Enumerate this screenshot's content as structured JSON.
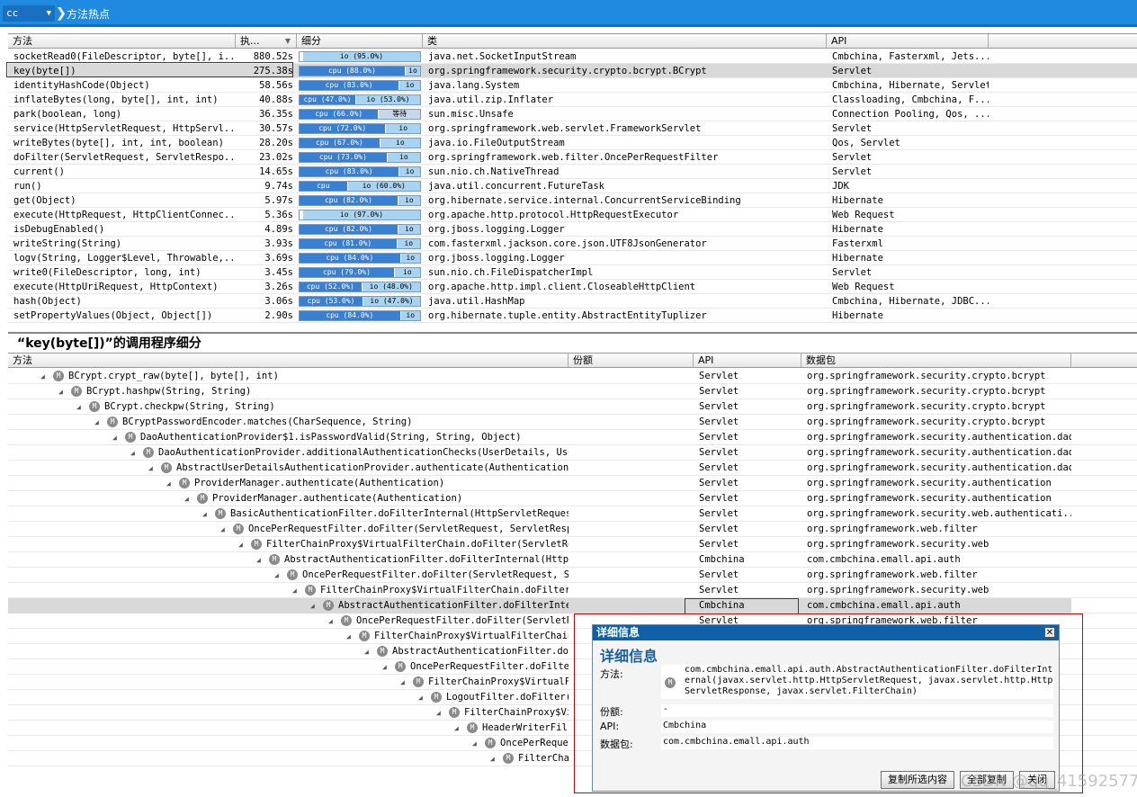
{
  "topbar": {
    "combo": "cc",
    "title": "方法热点"
  },
  "hot": {
    "headers": [
      "方法",
      "执...",
      "细分",
      "类",
      "API"
    ],
    "rows": [
      {
        "method": "socketRead0(FileDescriptor, byte[], i...",
        "time": "880.52s",
        "segs": [
          {
            "k": "io",
            "t": "io (95.0%)",
            "w": 0.97,
            "off": 0.03
          }
        ],
        "cls": "java.net.SocketInputStream",
        "api": "Cmbchina, Fasterxml, Jets..."
      },
      {
        "method": "key(byte[])",
        "time": "275.38s",
        "segs": [
          {
            "k": "cpu",
            "t": "cpu (88.0%)",
            "w": 0.88
          },
          {
            "k": "io",
            "t": "io",
            "w": 0.12
          }
        ],
        "cls": "org.springframework.security.crypto.bcrypt.BCrypt",
        "api": "Servlet"
      },
      {
        "method": "identityHashCode(Object)",
        "time": "58.56s",
        "segs": [
          {
            "k": "cpu",
            "t": "cpu (83.0%)",
            "w": 0.83
          },
          {
            "k": "io",
            "t": "io",
            "w": 0.17
          }
        ],
        "cls": "java.lang.System",
        "api": "Cmbchina, Hibernate, Servlet"
      },
      {
        "method": "inflateBytes(long, byte[], int, int)",
        "time": "40.88s",
        "segs": [
          {
            "k": "cpu",
            "t": "cpu (47.0%)",
            "w": 0.47
          },
          {
            "k": "io",
            "t": "io (53.0%)",
            "w": 0.53
          }
        ],
        "cls": "java.util.zip.Inflater",
        "api": "Classloading, Cmbchina, F..."
      },
      {
        "method": "park(boolean, long)",
        "time": "36.35s",
        "segs": [
          {
            "k": "cpu",
            "t": "cpu (66.0%)",
            "w": 0.66
          },
          {
            "k": "wait",
            "t": "等待",
            "w": 0.34
          }
        ],
        "cls": "sun.misc.Unsafe",
        "api": "Connection Pooling, Qos, ..."
      },
      {
        "method": "service(HttpServletRequest, HttpServl...",
        "time": "30.57s",
        "segs": [
          {
            "k": "cpu",
            "t": "cpu (72.0%)",
            "w": 0.72
          },
          {
            "k": "io",
            "t": "io",
            "w": 0.28
          }
        ],
        "cls": "org.springframework.web.servlet.FrameworkServlet",
        "api": "Servlet"
      },
      {
        "method": "writeBytes(byte[], int, int, boolean)",
        "time": "28.20s",
        "segs": [
          {
            "k": "cpu",
            "t": "cpu (67.0%)",
            "w": 0.67
          },
          {
            "k": "io",
            "t": "io",
            "w": 0.33
          }
        ],
        "cls": "java.io.FileOutputStream",
        "api": "Qos, Servlet"
      },
      {
        "method": "doFilter(ServletRequest, ServletRespo...",
        "time": "23.02s",
        "segs": [
          {
            "k": "cpu",
            "t": "cpu (73.0%)",
            "w": 0.73
          },
          {
            "k": "io",
            "t": "io",
            "w": 0.27
          }
        ],
        "cls": "org.springframework.web.filter.OncePerRequestFilter",
        "api": "Servlet"
      },
      {
        "method": "current()",
        "time": "14.65s",
        "segs": [
          {
            "k": "cpu",
            "t": "cpu (83.0%)",
            "w": 0.83
          },
          {
            "k": "io",
            "t": "io",
            "w": 0.17
          }
        ],
        "cls": "sun.nio.ch.NativeThread",
        "api": "Servlet"
      },
      {
        "method": "run()",
        "time": "9.74s",
        "segs": [
          {
            "k": "cpu",
            "t": "cpu",
            "w": 0.4
          },
          {
            "k": "io",
            "t": "io (60.0%)",
            "w": 0.6
          }
        ],
        "cls": "java.util.concurrent.FutureTask",
        "api": "JDK"
      },
      {
        "method": "get(Object)",
        "time": "5.97s",
        "segs": [
          {
            "k": "cpu",
            "t": "cpu (82.0%)",
            "w": 0.82
          },
          {
            "k": "io",
            "t": "io",
            "w": 0.18
          }
        ],
        "cls": "org.hibernate.service.internal.ConcurrentServiceBinding",
        "api": "Hibernate"
      },
      {
        "method": "execute(HttpRequest, HttpClientConnec...",
        "time": "5.36s",
        "segs": [
          {
            "k": "io",
            "t": "io (97.0%)",
            "w": 0.97,
            "off": 0.03
          }
        ],
        "cls": "org.apache.http.protocol.HttpRequestExecutor",
        "api": "Web Request"
      },
      {
        "method": "isDebugEnabled()",
        "time": "4.89s",
        "segs": [
          {
            "k": "cpu",
            "t": "cpu (82.0%)",
            "w": 0.82
          },
          {
            "k": "io",
            "t": "io",
            "w": 0.18
          }
        ],
        "cls": "org.jboss.logging.Logger",
        "api": "Hibernate"
      },
      {
        "method": "writeString(String)",
        "time": "3.93s",
        "segs": [
          {
            "k": "cpu",
            "t": "cpu (81.0%)",
            "w": 0.81
          },
          {
            "k": "io",
            "t": "io",
            "w": 0.19
          }
        ],
        "cls": "com.fasterxml.jackson.core.json.UTF8JsonGenerator",
        "api": "Fasterxml"
      },
      {
        "method": "logv(String, Logger$Level, Throwable,...",
        "time": "3.69s",
        "segs": [
          {
            "k": "cpu",
            "t": "cpu (84.0%)",
            "w": 0.84
          },
          {
            "k": "io",
            "t": "io",
            "w": 0.16
          }
        ],
        "cls": "org.jboss.logging.Logger",
        "api": "Hibernate"
      },
      {
        "method": "write0(FileDescriptor, long, int)",
        "time": "3.45s",
        "segs": [
          {
            "k": "cpu",
            "t": "cpu (79.0%)",
            "w": 0.79
          },
          {
            "k": "io",
            "t": "io",
            "w": 0.21
          }
        ],
        "cls": "sun.nio.ch.FileDispatcherImpl",
        "api": "Servlet"
      },
      {
        "method": "execute(HttpUriRequest, HttpContext)",
        "time": "3.26s",
        "segs": [
          {
            "k": "cpu",
            "t": "cpu (52.0%)",
            "w": 0.52
          },
          {
            "k": "io",
            "t": "io (48.0%)",
            "w": 0.48
          }
        ],
        "cls": "org.apache.http.impl.client.CloseableHttpClient",
        "api": "Web Request"
      },
      {
        "method": "hash(Object)",
        "time": "3.06s",
        "segs": [
          {
            "k": "cpu",
            "t": "cpu (53.0%)",
            "w": 0.53
          },
          {
            "k": "io",
            "t": "io (47.0%)",
            "w": 0.47
          }
        ],
        "cls": "java.util.HashMap",
        "api": "Cmbchina, Hibernate, JDBC..."
      },
      {
        "method": "setPropertyValues(Object, Object[])",
        "time": "2.90s",
        "segs": [
          {
            "k": "cpu",
            "t": "cpu (84.0%)",
            "w": 0.84
          },
          {
            "k": "io",
            "t": "io",
            "w": 0.16
          }
        ],
        "cls": "org.hibernate.tuple.entity.AbstractEntityTuplizer",
        "api": "Hibernate"
      }
    ]
  },
  "breakdown": {
    "title": "“key(byte[])”的调用程序细分",
    "headers": [
      "方法",
      "份额",
      "API",
      "数据包"
    ],
    "rows": [
      {
        "d": 0,
        "m": "BCrypt.crypt_raw(byte[], byte[], int)",
        "api": "Servlet",
        "pkg": "org.springframework.security.crypto.bcrypt"
      },
      {
        "d": 1,
        "m": "BCrypt.hashpw(String, String)",
        "api": "Servlet",
        "pkg": "org.springframework.security.crypto.bcrypt"
      },
      {
        "d": 2,
        "m": "BCrypt.checkpw(String, String)",
        "api": "Servlet",
        "pkg": "org.springframework.security.crypto.bcrypt"
      },
      {
        "d": 3,
        "m": "BCryptPasswordEncoder.matches(CharSequence, String)",
        "api": "Servlet",
        "pkg": "org.springframework.security.crypto.bcrypt"
      },
      {
        "d": 4,
        "m": "DaoAuthenticationProvider$1.isPasswordValid(String, String, Object)",
        "api": "Servlet",
        "pkg": "org.springframework.security.authentication.dao"
      },
      {
        "d": 5,
        "m": "DaoAuthenticationProvider.additionalAuthenticationChecks(UserDetails, Userna",
        "api": "Servlet",
        "pkg": "org.springframework.security.authentication.dao"
      },
      {
        "d": 6,
        "m": "AbstractUserDetailsAuthenticationProvider.authenticate(Authentication)",
        "api": "Servlet",
        "pkg": "org.springframework.security.authentication.dao"
      },
      {
        "d": 7,
        "m": "ProviderManager.authenticate(Authentication)",
        "api": "Servlet",
        "pkg": "org.springframework.security.authentication"
      },
      {
        "d": 8,
        "m": "ProviderManager.authenticate(Authentication)",
        "api": "Servlet",
        "pkg": "org.springframework.security.authentication"
      },
      {
        "d": 9,
        "m": "BasicAuthenticationFilter.doFilterInternal(HttpServletRequest,",
        "api": "Servlet",
        "pkg": "org.springframework.security.web.authenticati..."
      },
      {
        "d": 10,
        "m": "OncePerRequestFilter.doFilter(ServletRequest, ServletRespor",
        "api": "Servlet",
        "pkg": "org.springframework.web.filter"
      },
      {
        "d": 11,
        "m": "FilterChainProxy$VirtualFilterChain.doFilter(ServletReq",
        "api": "Servlet",
        "pkg": "org.springframework.security.web"
      },
      {
        "d": 12,
        "m": "AbstractAuthenticationFilter.doFilterInternal(HttpSe",
        "api": "Cmbchina",
        "pkg": "com.cmbchina.emall.api.auth"
      },
      {
        "d": 13,
        "m": "OncePerRequestFilter.doFilter(ServletRequest, Ser",
        "api": "Servlet",
        "pkg": "org.springframework.web.filter"
      },
      {
        "d": 14,
        "m": "FilterChainProxy$VirtualFilterChain.doFilter(S",
        "api": "Servlet",
        "pkg": "org.springframework.security.web"
      },
      {
        "d": 15,
        "m": "AbstractAuthenticationFilter.doFilterInter",
        "api": "Cmbchina",
        "pkg": "com.cmbchina.emall.api.auth"
      },
      {
        "d": 16,
        "m": "OncePerRequestFilter.doFilter(ServletRe",
        "api": "Servlet",
        "pkg": "org.springframework.web.filter"
      },
      {
        "d": 17,
        "m": "FilterChainProxy$VirtualFilterChain.",
        "api": "",
        "pkg": ""
      },
      {
        "d": 18,
        "m": "AbstractAuthenticationFilter.doF",
        "api": "",
        "pkg": ""
      },
      {
        "d": 19,
        "m": "OncePerRequestFilter.doFilter",
        "api": "",
        "pkg": ""
      },
      {
        "d": 20,
        "m": "FilterChainProxy$VirtualF:",
        "api": "",
        "pkg": ""
      },
      {
        "d": 21,
        "m": "LogoutFilter.doFilter(",
        "api": "",
        "pkg": ""
      },
      {
        "d": 22,
        "m": "FilterChainProxy$Vi",
        "api": "",
        "pkg": ""
      },
      {
        "d": 23,
        "m": "HeaderWriterFil",
        "api": "",
        "pkg": ""
      },
      {
        "d": 24,
        "m": "OncePerReque",
        "api": "",
        "pkg": ""
      },
      {
        "d": 25,
        "m": "FilterCha",
        "api": "",
        "pkg": ""
      }
    ]
  },
  "dialog": {
    "title": "详细信息",
    "heading": "详细信息",
    "method_label": "方法:",
    "method_value": "com.cmbchina.emall.api.auth.AbstractAuthenticationFilter.doFilterInternal(javax.servlet.http.HttpServletRequest, javax.servlet.http.HttpServletResponse, javax.servlet.FilterChain)",
    "share_label": "份额:",
    "share_value": "-",
    "api_label": "API:",
    "api_value": "Cmbchina",
    "pkg_label": "数据包:",
    "pkg_value": "com.cmbchina.emall.api.auth",
    "copy_selected": "复制所选内容",
    "copy_all": "全部复制",
    "close": "关闭"
  },
  "watermark": "CSDN @qq_41592577",
  "colors": {
    "titlebar": "#1f8ae0",
    "cpu": "#3a7fd0",
    "io": "#a8d4f2",
    "highlight": "#d00000"
  }
}
